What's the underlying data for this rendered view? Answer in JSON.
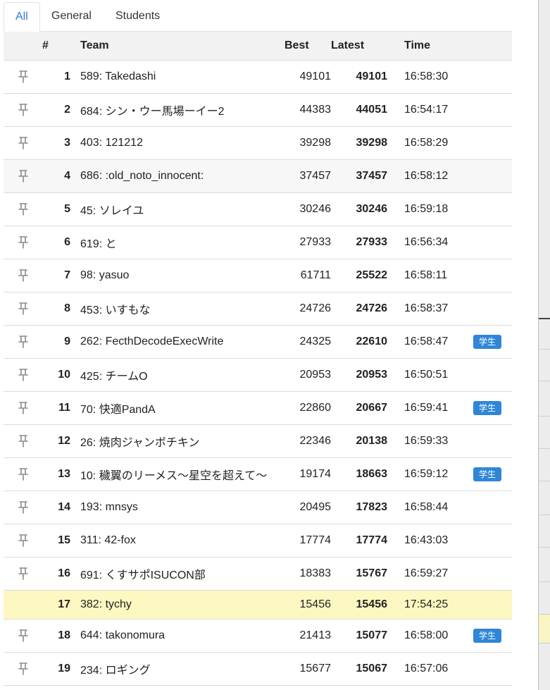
{
  "tabs": [
    {
      "label": "All",
      "active": true
    },
    {
      "label": "General",
      "active": false
    },
    {
      "label": "Students",
      "active": false
    }
  ],
  "columns": {
    "rank": "#",
    "team": "Team",
    "best": "Best",
    "latest": "Latest",
    "time": "Time"
  },
  "student_badge_label": "学生",
  "accent_color": "#3479d9",
  "badge_color": "#2f86d6",
  "highlight_color": "#fdf8c1",
  "pin_icon": "pin-icon",
  "rows": [
    {
      "rank": "1",
      "team": "589: Takedashi",
      "best": "49101",
      "latest": "49101",
      "time": "16:58:30",
      "student": false,
      "pin": true
    },
    {
      "rank": "2",
      "team": "684: シン・ウー馬場ーイー2",
      "best": "44383",
      "latest": "44051",
      "time": "16:54:17",
      "student": false,
      "pin": true
    },
    {
      "rank": "3",
      "team": "403: 121212",
      "best": "39298",
      "latest": "39298",
      "time": "16:58:29",
      "student": false,
      "pin": true
    },
    {
      "rank": "4",
      "team": "686: :old_noto_innocent:",
      "best": "37457",
      "latest": "37457",
      "time": "16:58:12",
      "student": false,
      "pin": true
    },
    {
      "rank": "5",
      "team": "45: ソレイユ",
      "best": "30246",
      "latest": "30246",
      "time": "16:59:18",
      "student": false,
      "pin": true
    },
    {
      "rank": "6",
      "team": "619: と",
      "best": "27933",
      "latest": "27933",
      "time": "16:56:34",
      "student": false,
      "pin": true
    },
    {
      "rank": "7",
      "team": "98: yasuo",
      "best": "61711",
      "latest": "25522",
      "time": "16:58:11",
      "student": false,
      "pin": true
    },
    {
      "rank": "8",
      "team": "453: いすもな",
      "best": "24726",
      "latest": "24726",
      "time": "16:58:37",
      "student": false,
      "pin": true
    },
    {
      "rank": "9",
      "team": "262: FecthDecodeExecWrite",
      "best": "24325",
      "latest": "22610",
      "time": "16:58:47",
      "student": true,
      "pin": true
    },
    {
      "rank": "10",
      "team": "425: チームO",
      "best": "20953",
      "latest": "20953",
      "time": "16:50:51",
      "student": false,
      "pin": true
    },
    {
      "rank": "11",
      "team": "70: 快適PandA",
      "best": "22860",
      "latest": "20667",
      "time": "16:59:41",
      "student": true,
      "pin": true
    },
    {
      "rank": "12",
      "team": "26: 焼肉ジャンボチキン",
      "best": "22346",
      "latest": "20138",
      "time": "16:59:33",
      "student": false,
      "pin": true
    },
    {
      "rank": "13",
      "team": "10: 穢翼のリーメス〜星空を超えて〜",
      "best": "19174",
      "latest": "18663",
      "time": "16:59:12",
      "student": true,
      "pin": true
    },
    {
      "rank": "14",
      "team": "193: mnsys",
      "best": "20495",
      "latest": "17823",
      "time": "16:58:44",
      "student": false,
      "pin": true
    },
    {
      "rank": "15",
      "team": "311: 42-fox",
      "best": "17774",
      "latest": "17774",
      "time": "16:43:03",
      "student": false,
      "pin": true
    },
    {
      "rank": "16",
      "team": "691: くすサポISUCON部",
      "best": "18383",
      "latest": "15767",
      "time": "16:59:27",
      "student": false,
      "pin": true
    },
    {
      "rank": "17",
      "team": "382: tychy",
      "best": "15456",
      "latest": "15456",
      "time": "17:54:25",
      "student": false,
      "pin": false,
      "highlight": true
    },
    {
      "rank": "18",
      "team": "644: takonomura",
      "best": "21413",
      "latest": "15077",
      "time": "16:58:00",
      "student": true,
      "pin": true
    },
    {
      "rank": "19",
      "team": "234: ロギング",
      "best": "15677",
      "latest": "15067",
      "time": "16:57:06",
      "student": false,
      "pin": true
    }
  ]
}
